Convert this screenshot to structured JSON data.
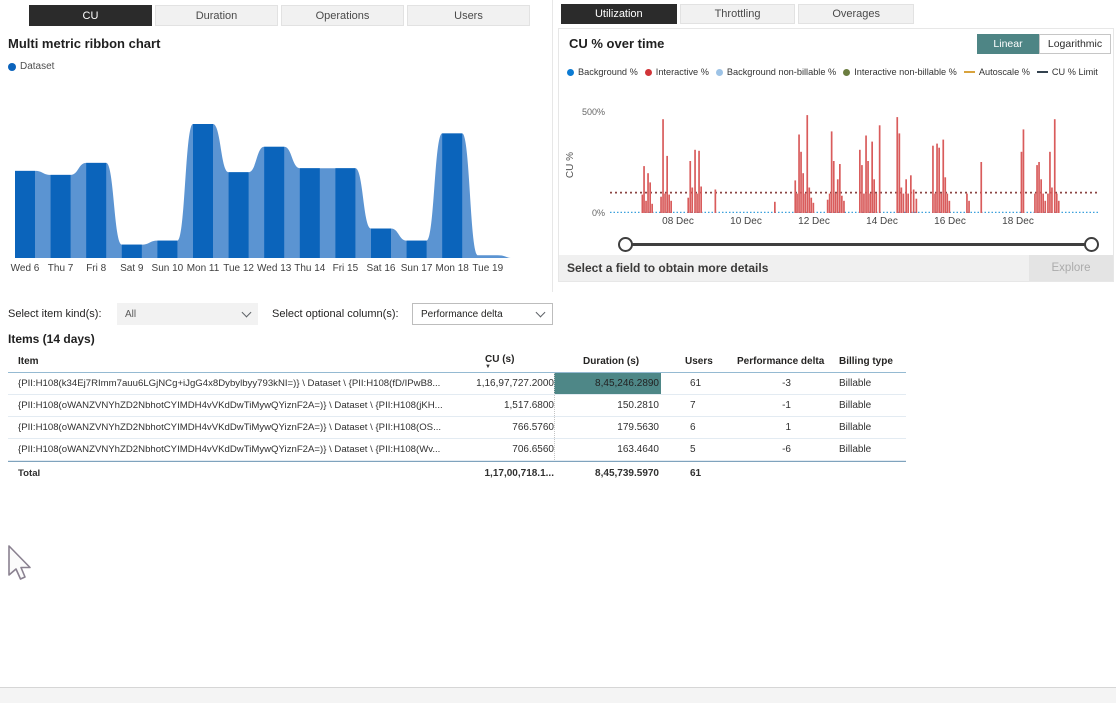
{
  "left_panel": {
    "tabs": [
      {
        "label": "CU",
        "selected": true
      },
      {
        "label": "Duration",
        "selected": false
      },
      {
        "label": "Operations",
        "selected": false
      },
      {
        "label": "Users",
        "selected": false
      }
    ],
    "title": "Multi metric ribbon chart",
    "legend": [
      {
        "label": "Dataset",
        "color": "#0B63BC",
        "type": "dot"
      }
    ]
  },
  "right_panel": {
    "tabs": [
      {
        "label": "Utilization",
        "selected": true
      },
      {
        "label": "Throttling",
        "selected": false
      },
      {
        "label": "Overages",
        "selected": false
      }
    ],
    "title": "CU % over time",
    "scale_buttons": [
      {
        "label": "Linear",
        "selected": true
      },
      {
        "label": "Logarithmic",
        "selected": false
      }
    ],
    "legend": [
      {
        "label": "Background %",
        "color": "#0C7BD3",
        "type": "dot"
      },
      {
        "label": "Interactive %",
        "color": "#D13438",
        "type": "dot"
      },
      {
        "label": "Background non-billable %",
        "color": "#9DC3E6",
        "type": "dot"
      },
      {
        "label": "Interactive non-billable %",
        "color": "#6B7D3F",
        "type": "dot"
      },
      {
        "label": "Autoscale %",
        "color": "#D8A33D",
        "type": "line"
      },
      {
        "label": "CU % Limit",
        "color": "#33424F",
        "type": "line"
      }
    ],
    "hint": "Select a field to obtain more details",
    "explore_label": "Explore"
  },
  "filters": {
    "item_kind_label": "Select item kind(s):",
    "item_kind_value": "All",
    "optional_columns_label": "Select optional column(s):",
    "optional_columns_value": "Performance delta"
  },
  "items_table": {
    "title": "Items (14 days)",
    "columns": [
      "Item",
      "CU (s)",
      "Duration (s)",
      "Users",
      "Performance delta",
      "Billing type"
    ],
    "sort_column": "CU (s)",
    "sort_direction": "desc",
    "rows": [
      {
        "item": "{PII:H108(k34Ej7RImm7auu6LGjNCg+iJgG4x8Dybylbyy793kNI=)} \\ Dataset \\ {PII:H108(fD/IPwB8...",
        "cu": "1,16,97,727.2000",
        "duration": "8,45,246.2890",
        "users": "61",
        "perf_delta": "-3",
        "billing": "Billable",
        "duration_highlighted": true
      },
      {
        "item": "{PII:H108(oWANZVNYhZD2NbhotCYIMDH4vVKdDwTiMywQYiznF2A=)} \\ Dataset \\ {PII:H108(jKH...",
        "cu": "1,517.6800",
        "duration": "150.2810",
        "users": "7",
        "perf_delta": "-1",
        "billing": "Billable",
        "duration_highlighted": false
      },
      {
        "item": "{PII:H108(oWANZVNYhZD2NbhotCYIMDH4vVKdDwTiMywQYiznF2A=)} \\ Dataset \\ {PII:H108(OS...",
        "cu": "766.5760",
        "duration": "179.5630",
        "users": "6",
        "perf_delta": "1",
        "billing": "Billable",
        "duration_highlighted": false
      },
      {
        "item": "{PII:H108(oWANZVNYhZD2NbhotCYIMDH4vVKdDwTiMywQYiznF2A=)} \\ Dataset \\ {PII:H108(Wv...",
        "cu": "706.6560",
        "duration": "163.4640",
        "users": "5",
        "perf_delta": "-6",
        "billing": "Billable",
        "duration_highlighted": false
      }
    ],
    "total": {
      "label": "Total",
      "cu": "1,17,00,718.1...",
      "duration": "8,45,739.5970",
      "users": "61",
      "perf_delta": "",
      "billing": ""
    }
  },
  "chart_data": [
    {
      "type": "area",
      "name": "multi-metric-ribbon",
      "title": "Multi metric ribbon chart",
      "series_name": "Dataset",
      "categories": [
        "Wed 6",
        "Thu 7",
        "Fri 8",
        "Sat 9",
        "Sun 10",
        "Mon 11",
        "Tue 12",
        "Wed 13",
        "Thu 14",
        "Fri 15",
        "Sat 16",
        "Sun 17",
        "Mon 18",
        "Tue 19"
      ],
      "values": [
        65,
        62,
        71,
        10,
        13,
        100,
        64,
        83,
        67,
        67,
        22,
        13,
        93,
        2
      ],
      "value_unit": "percent-of-max",
      "bar_color": "#0B64BB",
      "ribbon_color": "#5B94D2",
      "label_color": "#3f3f3f",
      "legend_position": "top-left",
      "grid": false
    },
    {
      "type": "bar",
      "name": "cu-percent-over-time",
      "title": "CU % over time",
      "ylabel": "CU %",
      "ylim": [
        0,
        500
      ],
      "yticks": [
        "0%",
        "500%"
      ],
      "xticks": [
        "08 Dec",
        "10 Dec",
        "12 Dec",
        "14 Dec",
        "16 Dec",
        "18 Dec"
      ],
      "xtick_days": [
        8,
        10,
        12,
        14,
        16,
        18
      ],
      "x_day_range": [
        6,
        20.4
      ],
      "cu_limit_pct": 100,
      "cu_limit_color": "#8B4543",
      "grid": false,
      "legend_position": "top",
      "series": [
        {
          "name": "Interactive %",
          "color": "#D95C5C",
          "points": [
            [
              6.95,
              90
            ],
            [
              7.0,
              230
            ],
            [
              7.06,
              60
            ],
            [
              7.12,
              195
            ],
            [
              7.18,
              150
            ],
            [
              7.24,
              45
            ],
            [
              7.5,
              80
            ],
            [
              7.56,
              460
            ],
            [
              7.62,
              95
            ],
            [
              7.68,
              280
            ],
            [
              7.74,
              90
            ],
            [
              7.8,
              60
            ],
            [
              8.3,
              75
            ],
            [
              8.36,
              255
            ],
            [
              8.42,
              125
            ],
            [
              8.5,
              310
            ],
            [
              8.56,
              95
            ],
            [
              8.62,
              305
            ],
            [
              8.68,
              130
            ],
            [
              9.1,
              115
            ],
            [
              10.85,
              55
            ],
            [
              11.45,
              160
            ],
            [
              11.5,
              95
            ],
            [
              11.56,
              385
            ],
            [
              11.62,
              300
            ],
            [
              11.68,
              195
            ],
            [
              11.74,
              95
            ],
            [
              11.8,
              480
            ],
            [
              11.86,
              125
            ],
            [
              11.92,
              75
            ],
            [
              11.98,
              50
            ],
            [
              12.4,
              65
            ],
            [
              12.46,
              95
            ],
            [
              12.52,
              400
            ],
            [
              12.58,
              255
            ],
            [
              12.64,
              95
            ],
            [
              12.7,
              165
            ],
            [
              12.76,
              240
            ],
            [
              12.82,
              85
            ],
            [
              12.88,
              60
            ],
            [
              13.35,
              310
            ],
            [
              13.41,
              235
            ],
            [
              13.47,
              95
            ],
            [
              13.53,
              380
            ],
            [
              13.59,
              255
            ],
            [
              13.65,
              95
            ],
            [
              13.71,
              350
            ],
            [
              13.77,
              165
            ],
            [
              13.83,
              95
            ],
            [
              13.93,
              430
            ],
            [
              14.45,
              470
            ],
            [
              14.51,
              390
            ],
            [
              14.57,
              125
            ],
            [
              14.63,
              95
            ],
            [
              14.71,
              165
            ],
            [
              14.77,
              95
            ],
            [
              14.85,
              185
            ],
            [
              14.93,
              115
            ],
            [
              15.01,
              70
            ],
            [
              15.5,
              330
            ],
            [
              15.56,
              95
            ],
            [
              15.62,
              340
            ],
            [
              15.68,
              320
            ],
            [
              15.74,
              95
            ],
            [
              15.8,
              360
            ],
            [
              15.86,
              175
            ],
            [
              15.92,
              95
            ],
            [
              15.98,
              60
            ],
            [
              16.5,
              95
            ],
            [
              16.56,
              60
            ],
            [
              16.92,
              250
            ],
            [
              18.1,
              300
            ],
            [
              18.16,
              410
            ],
            [
              18.5,
              95
            ],
            [
              18.56,
              235
            ],
            [
              18.62,
              250
            ],
            [
              18.68,
              165
            ],
            [
              18.74,
              95
            ],
            [
              18.8,
              60
            ],
            [
              18.88,
              95
            ],
            [
              18.94,
              300
            ],
            [
              19.0,
              125
            ],
            [
              19.08,
              460
            ],
            [
              19.14,
              95
            ],
            [
              19.2,
              60
            ]
          ]
        },
        {
          "name": "Background %",
          "color": "#3AA0DC",
          "baseline_pct": 1
        }
      ]
    }
  ]
}
